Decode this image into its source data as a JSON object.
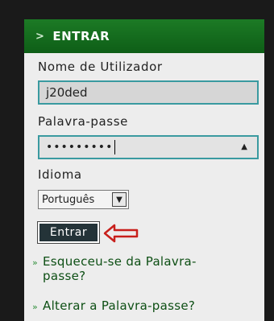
{
  "header": {
    "title": "ENTRAR",
    "chevron": ">"
  },
  "username": {
    "label": "Nome de Utilizador",
    "value": "j20ded"
  },
  "password": {
    "label": "Palavra-passe",
    "masked_value": "•••••••••"
  },
  "language": {
    "label": "Idioma",
    "selected": "Português"
  },
  "login_button": {
    "label": "Entrar"
  },
  "links": [
    {
      "line1": "Esqueceu-se da Palavra-",
      "line2": "passe?"
    },
    {
      "line1": "Alterar a Palavra-passe?"
    }
  ],
  "colors": {
    "header_green": "#0e5e17",
    "field_border": "#3a9aa0",
    "arrow_red": "#c8201c"
  }
}
